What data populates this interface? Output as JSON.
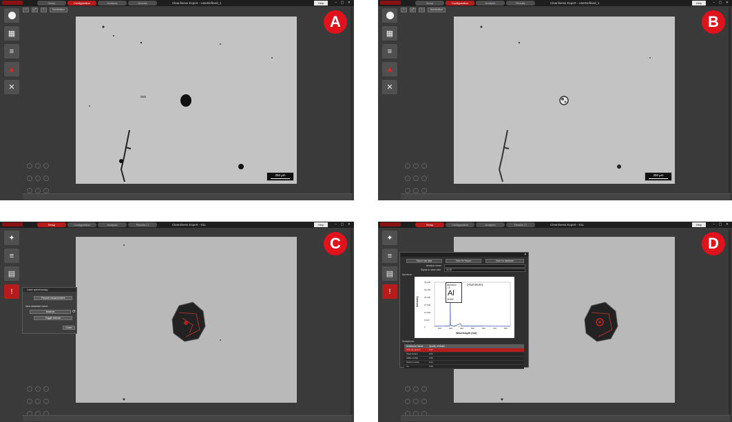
{
  "panels": {
    "a": {
      "badge": "A",
      "title": "Cleanliness Expert - UserDefined_1",
      "help": "Help",
      "tabs": [
        "Setup",
        "Configuration",
        "Analysis",
        "Results"
      ],
      "active_tab": 1,
      "toolbar_text": "Illumination",
      "scale": "250 µm"
    },
    "b": {
      "badge": "B",
      "title": "Cleanliness Expert - UserDefined_1",
      "help": "Help",
      "tabs": [
        "Setup",
        "Configuration",
        "Analysis",
        "Results"
      ],
      "active_tab": 1,
      "toolbar_text": "Illumination",
      "scale": "250 µm"
    },
    "c": {
      "badge": "C",
      "title": "Cleanliness Expert - 011",
      "help": "Help",
      "tabs": [
        "Setup",
        "Configuration",
        "Analysis",
        "Results ☐"
      ],
      "active_tab": 0,
      "dialog": {
        "header": "Laser spectroscopy",
        "prepare": "Prepare measurement",
        "new_db_label": "New database name:",
        "db_select": "Material",
        "toggle": "Toggle reticule",
        "close": "Close"
      }
    },
    "d": {
      "badge": "D",
      "title": "Cleanliness Expert - 011",
      "help": "Help",
      "tabs": [
        "Setup",
        "Configuration",
        "Analysis",
        "Results ☐"
      ],
      "active_tab": 0,
      "dialog": {
        "buttons": [
          "Export raw data",
          "Save for Report",
          "Save for database"
        ],
        "analysis_name_label": "Analysis name:",
        "signal_ratio_label": "Signal to noise ratio:",
        "signal_ratio_value": "43.48",
        "spectrum_label": "Spectrum",
        "substances_label": "Substances",
        "chart_title": "(Aluminum)",
        "ylabel": "Intensity",
        "xlabel": "Wavelength (nm)",
        "yticks": [
          "30,000",
          "25,000",
          "20,000",
          "15,000",
          "10,000",
          "5,000",
          "0"
        ],
        "xticks": [
          "200",
          "300",
          "400",
          "500",
          "600",
          "700",
          "800"
        ],
        "element": {
          "name": "aluminum",
          "number": "13",
          "symbol": "Al",
          "mass": "26.982"
        },
        "table_headers": [
          "Substance Name",
          "Quality of Match"
        ],
        "table_rows": [
          [
            "Al/Al aluminium",
            "0.97"
          ],
          [
            "Steel carbon",
            "0.61"
          ],
          [
            "AlMG Cu/Mn",
            "0.56"
          ],
          [
            "Natrium oxide",
            "0.41"
          ],
          [
            "Cu",
            "0.30"
          ]
        ]
      }
    }
  },
  "chart_data": {
    "type": "line",
    "title": "(Aluminum)",
    "xlabel": "Wavelength (nm)",
    "ylabel": "Intensity",
    "xlim": [
      180,
      800
    ],
    "ylim": [
      0,
      30000
    ],
    "series": [
      {
        "x": [
          180,
          200,
          220,
          250,
          300,
          308,
          309,
          310,
          340,
          394,
          396,
          400,
          500,
          600,
          700,
          800
        ],
        "y": [
          0,
          200,
          100,
          150,
          300,
          1500,
          27000,
          800,
          200,
          1800,
          1500,
          300,
          250,
          150,
          100,
          50
        ]
      }
    ]
  }
}
